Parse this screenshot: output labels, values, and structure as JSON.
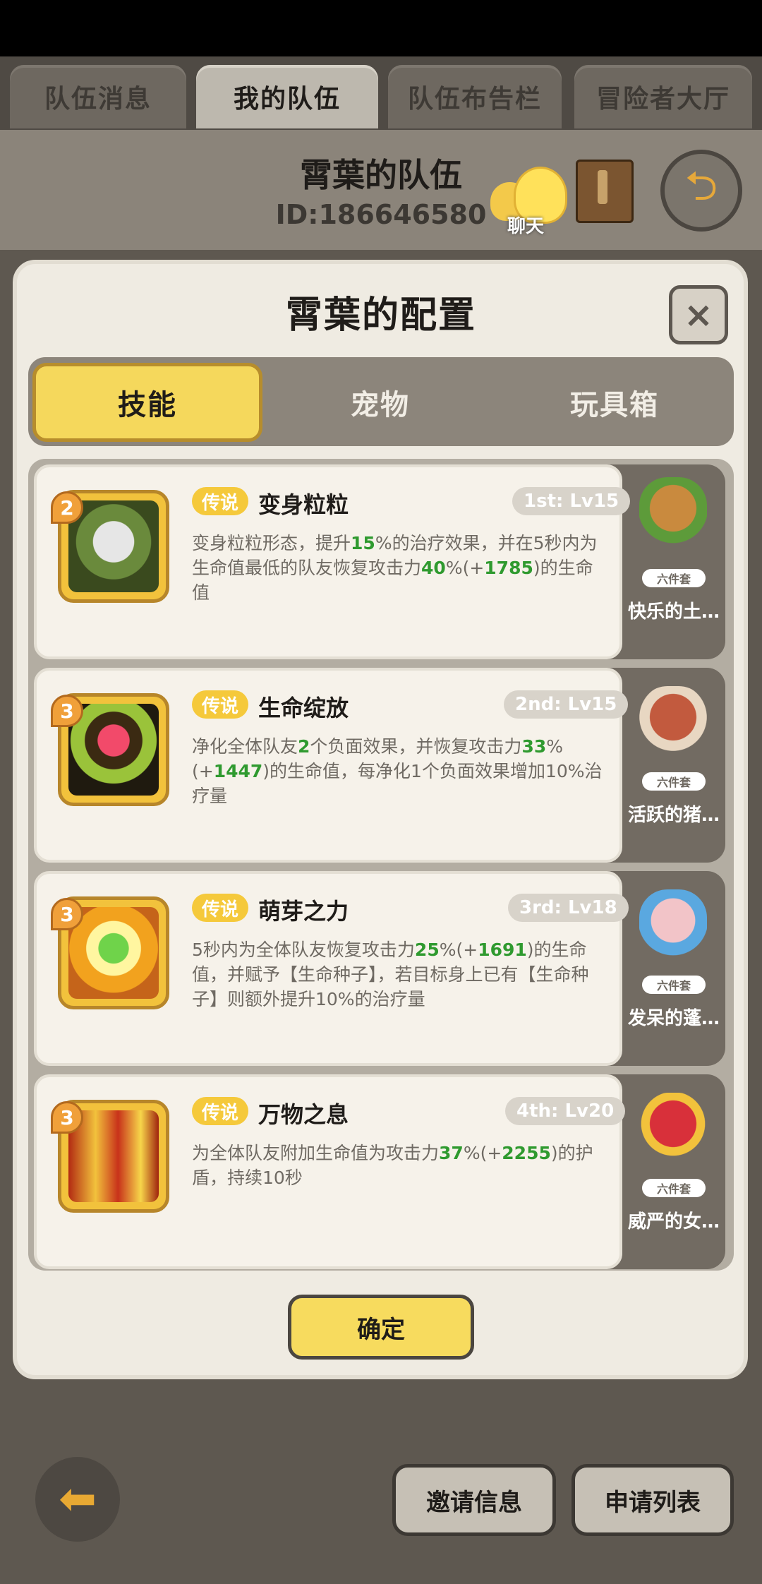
{
  "tabs": [
    {
      "label": "队伍消息"
    },
    {
      "label": "我的队伍"
    },
    {
      "label": "队伍布告栏"
    },
    {
      "label": "冒险者大厅"
    }
  ],
  "header": {
    "team_name": "霄葉的队伍",
    "team_id": "ID:186646580",
    "chat_label": "聊天"
  },
  "panel": {
    "title": "霄葉的配置",
    "close_symbol": "×",
    "segments": [
      {
        "label": "技能",
        "active": true
      },
      {
        "label": "宠物",
        "active": false
      },
      {
        "label": "玩具箱",
        "active": false
      }
    ],
    "confirm_label": "确定"
  },
  "skills": [
    {
      "level_badge": "2",
      "rarity": "传说",
      "name": "变身粒粒",
      "slot": "1st: Lv15",
      "icon": "owl-icon",
      "desc_parts": [
        "变身粒粒形态，提升",
        "15",
        "%的治疗效果，并在5秒内为生命值最低的队友恢复攻击力",
        "40",
        "%(+",
        "1785",
        ")的生命值"
      ]
    },
    {
      "level_badge": "3",
      "rarity": "传说",
      "name": "生命绽放",
      "slot": "2nd: Lv15",
      "icon": "heart-flower-icon",
      "desc_parts": [
        "净化全体队友",
        "2",
        "个负面效果，并恢复攻击力",
        "33",
        "%(+",
        "1447",
        ")的生命值，每净化1个负面效果增加10%治疗量"
      ]
    },
    {
      "level_badge": "3",
      "rarity": "传说",
      "name": "萌芽之力",
      "slot": "3rd: Lv18",
      "icon": "sprout-icon",
      "desc_parts": [
        "5秒内为全体队友恢复攻击力",
        "25",
        "%(+",
        "1691",
        ")的生命值，并赋予【生命种子】，若目标身上已有【生命种子】则额外提升10%的治疗量"
      ]
    },
    {
      "level_badge": "3",
      "rarity": "传说",
      "name": "万物之息",
      "slot": "4th: Lv20",
      "icon": "healing-cross-icon",
      "desc_parts": [
        "为全体队友附加生命值为攻击力",
        "37",
        "%(+",
        "2255",
        ")的护盾，持续10秒"
      ]
    }
  ],
  "pets": [
    {
      "name": "快乐的土…",
      "set_label": "六件套"
    },
    {
      "name": "活跃的猪…",
      "set_label": "六件套"
    },
    {
      "name": "发呆的蓬…",
      "set_label": "六件套"
    },
    {
      "name": "威严的女…",
      "set_label": "六件套"
    }
  ],
  "footer": {
    "invite_label": "邀请信息",
    "apply_label": "申请列表"
  },
  "colors": {
    "accent_yellow": "#f5d85c",
    "highlight_green": "#2f9a2f",
    "rarity_badge": "#f5c93b"
  }
}
